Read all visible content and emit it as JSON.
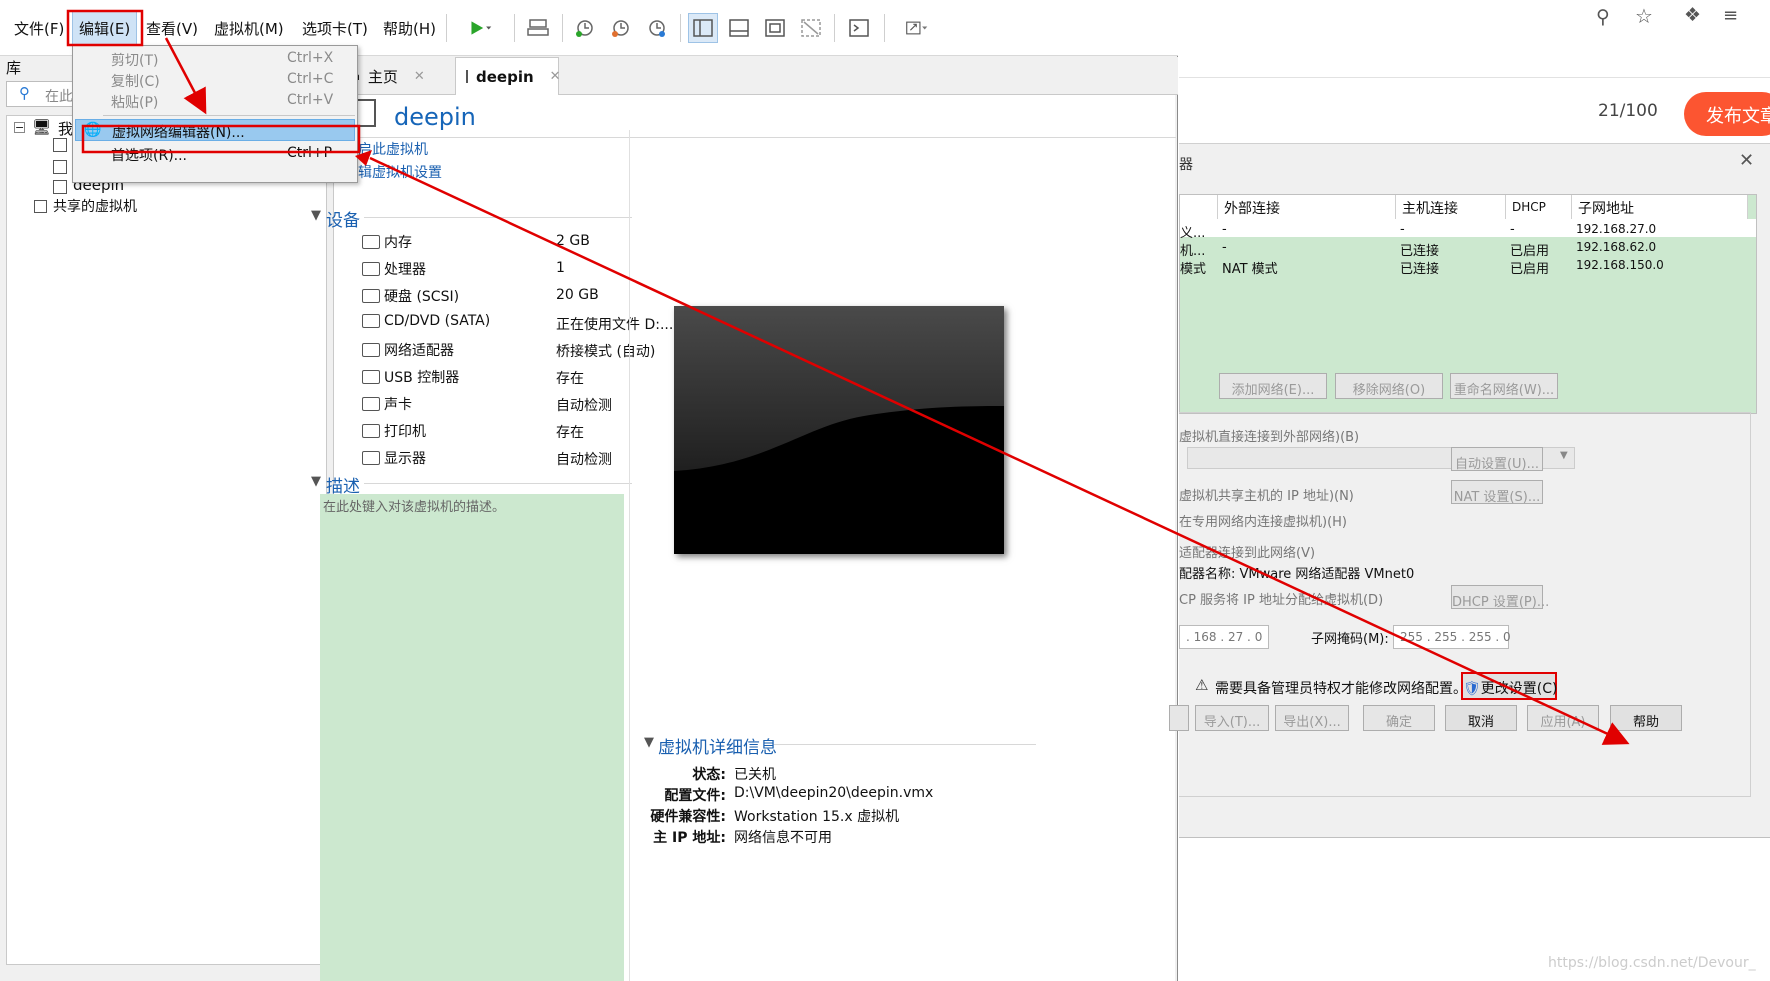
{
  "menubar": {
    "file": "文件(F)",
    "edit": "编辑(E)",
    "view": "查看(V)",
    "vm": "虚拟机(M)",
    "tabs": "选项卡(T)",
    "help": "帮助(H)"
  },
  "edit_menu": {
    "cut": {
      "label": "剪切(T)",
      "shortcut": "Ctrl+X"
    },
    "copy": {
      "label": "复制(C)",
      "shortcut": "Ctrl+C"
    },
    "paste": {
      "label": "粘贴(P)",
      "shortcut": "Ctrl+V"
    },
    "vnet_editor": {
      "label": "虚拟网络编辑器(N)..."
    },
    "preferences": {
      "label": "首选项(R)...",
      "shortcut": "Ctrl+P"
    }
  },
  "library": {
    "title": "库",
    "search_placeholder": "在此",
    "my_computer": "我",
    "vm_deepin": "deepin",
    "shared_vms": "共享的虚拟机"
  },
  "tabs": [
    {
      "label": "主页"
    },
    {
      "label": "deepin"
    }
  ],
  "vm": {
    "title": "deepin",
    "power_on": "开启此虚拟机",
    "edit_settings": "编辑虚拟机设置",
    "devices_heading": "设备",
    "devices": [
      {
        "name": "内存",
        "value": "2 GB",
        "icon": "memory-icon"
      },
      {
        "name": "处理器",
        "value": "1",
        "icon": "cpu-icon"
      },
      {
        "name": "硬盘 (SCSI)",
        "value": "20 GB",
        "icon": "disk-icon"
      },
      {
        "name": "CD/DVD (SATA)",
        "value": "正在使用文件 D:...",
        "icon": "cd-icon"
      },
      {
        "name": "网络适配器",
        "value": "桥接模式 (自动)",
        "icon": "network-icon"
      },
      {
        "name": "USB 控制器",
        "value": "存在",
        "icon": "usb-icon"
      },
      {
        "name": "声卡",
        "value": "自动检测",
        "icon": "sound-icon"
      },
      {
        "name": "打印机",
        "value": "存在",
        "icon": "printer-icon"
      },
      {
        "name": "显示器",
        "value": "自动检测",
        "icon": "monitor-icon"
      }
    ],
    "desc_heading": "描述",
    "desc_placeholder": "在此处键入对该虚拟机的描述。",
    "details_heading": "虚拟机详细信息",
    "details": [
      {
        "key": "状态:",
        "value": "已关机"
      },
      {
        "key": "配置文件:",
        "value": "D:\\VM\\deepin20\\deepin.vmx"
      },
      {
        "key": "硬件兼容性:",
        "value": "Workstation 15.x 虚拟机"
      },
      {
        "key": "主 IP 地址:",
        "value": "网络信息不可用"
      }
    ]
  },
  "browser": {
    "counter": "21/100",
    "publish": "发布文章"
  },
  "net_editor": {
    "title_fragment": "器",
    "columns": [
      "外部连接",
      "主机连接",
      "DHCP",
      "子网地址"
    ],
    "rows": [
      {
        "type": "义...",
        "external": "-",
        "host": "-",
        "dhcp": "-",
        "subnet": "192.168.27.0"
      },
      {
        "type": "机...",
        "external": "-",
        "host": "已连接",
        "dhcp": "已启用",
        "subnet": "192.168.62.0"
      },
      {
        "type": "模式",
        "external": "NAT 模式",
        "host": "已连接",
        "dhcp": "已启用",
        "subnet": "192.168.150.0"
      }
    ],
    "add_network": "添加网络(E)...",
    "remove_network": "移除网络(O)",
    "rename_network": "重命名网络(W)...",
    "bridged_label": "虚拟机直接连接到外部网络)(B)",
    "auto_settings": "自动设置(U)...",
    "nat_label": "虚拟机共享主机的 IP 地址)(N)",
    "nat_settings": "NAT 设置(S)...",
    "hostonly_label": "在专用网络内连接虚拟机)(H)",
    "adapter_label": "适配器连接到此网络(V)",
    "adapter_name": "配器名称: VMware 网络适配器 VMnet0",
    "dhcp_label": "CP 服务将 IP 地址分配给虚拟机(D)",
    "dhcp_settings": "DHCP 设置(P)...",
    "subnet_ip": ". 168 . 27 . 0",
    "mask_label": "子网掩码(M):",
    "mask_value": "255 . 255 . 255 . 0",
    "admin_warning": "需要具备管理员特权才能修改网络配置。",
    "change_settings": "更改设置(C)",
    "import": "导入(T)...",
    "export": "导出(X)...",
    "ok": "确定",
    "cancel": "取消",
    "apply": "应用(A)",
    "help": "帮助"
  },
  "watermark": "https://blog.csdn.net/Devour_",
  "colors": {
    "annotation_red": "#e00000",
    "accent_blue": "#1a60b0",
    "table_green": "#cce8cf",
    "publish_orange": "#fc5531"
  }
}
